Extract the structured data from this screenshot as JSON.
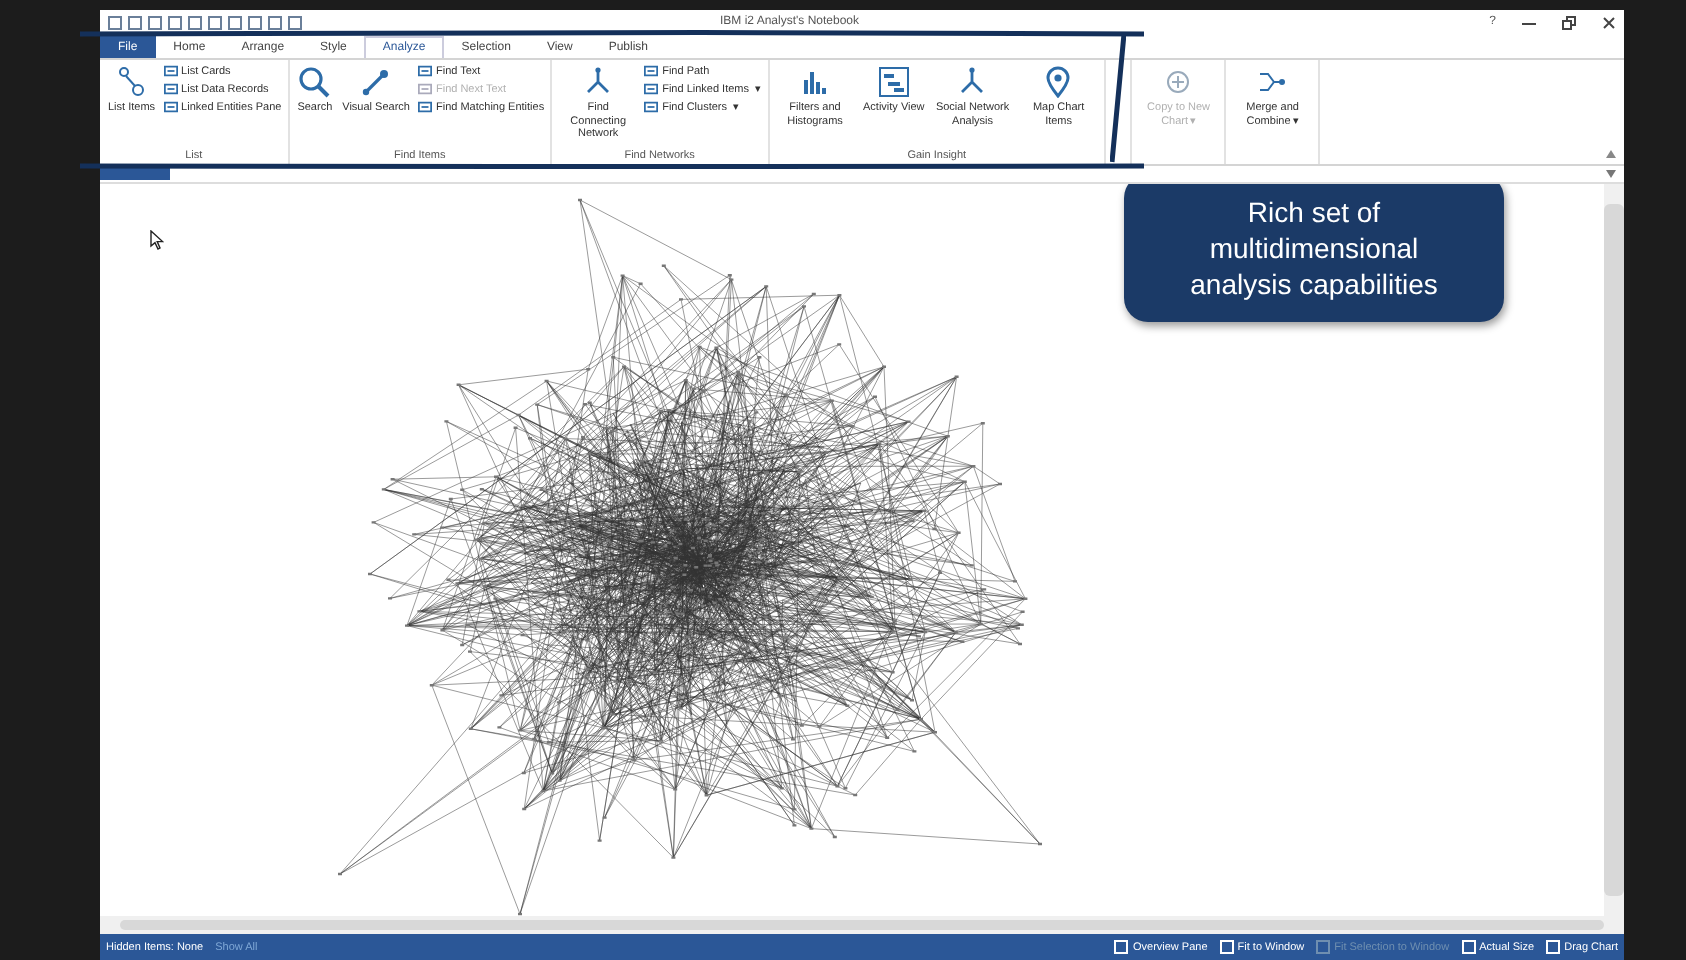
{
  "window": {
    "title": "IBM i2 Analyst's Notebook",
    "help": "?"
  },
  "tabs": [
    {
      "label": "File",
      "selected": false,
      "kind": "file"
    },
    {
      "label": "Home",
      "selected": false
    },
    {
      "label": "Arrange",
      "selected": false
    },
    {
      "label": "Style",
      "selected": false
    },
    {
      "label": "Analyze",
      "selected": true
    },
    {
      "label": "Selection",
      "selected": false
    },
    {
      "label": "View",
      "selected": false
    },
    {
      "label": "Publish",
      "selected": false
    }
  ],
  "ribbon_groups": [
    {
      "label": "List",
      "items": [
        {
          "label": "List Items",
          "kind": "large",
          "disabled": false
        },
        {
          "label": "List Cards",
          "kind": "small",
          "disabled": false
        },
        {
          "label": "List Data Records",
          "kind": "small",
          "disabled": false
        },
        {
          "label": "Linked Entities Pane",
          "kind": "small",
          "disabled": false
        }
      ]
    },
    {
      "label": "Find Items",
      "items": [
        {
          "label": "Search",
          "kind": "large",
          "disabled": false
        },
        {
          "label": "Visual Search",
          "kind": "large",
          "disabled": false
        },
        {
          "label": "Find Text",
          "kind": "small",
          "disabled": false
        },
        {
          "label": "Find Next Text",
          "kind": "small",
          "disabled": true
        },
        {
          "label": "Find Matching Entities",
          "kind": "small",
          "disabled": false
        }
      ]
    },
    {
      "label": "Find Networks",
      "items": [
        {
          "label": "Find Connecting Network",
          "kind": "large",
          "disabled": false
        },
        {
          "label": "Find Path",
          "kind": "small",
          "disabled": false
        },
        {
          "label": "Find Linked Items",
          "kind": "small",
          "disabled": false,
          "caret": "▾"
        },
        {
          "label": "Find Clusters",
          "kind": "small",
          "disabled": false,
          "caret": "▾"
        }
      ]
    },
    {
      "label": "Gain Insight",
      "items": [
        {
          "label": "Filters and Histograms",
          "kind": "large",
          "disabled": false
        },
        {
          "label": "Activity View",
          "kind": "large",
          "disabled": false
        },
        {
          "label": "Social Network Analysis",
          "kind": "large",
          "disabled": false
        },
        {
          "label": "Map Chart Items",
          "kind": "large",
          "disabled": false
        }
      ]
    },
    {
      "items": [
        {
          "label": "Copy to New Chart",
          "kind": "large",
          "disabled": true,
          "caret": "▾"
        }
      ]
    },
    {
      "items": [
        {
          "label": "Merge and Combine",
          "kind": "large",
          "disabled": false,
          "caret": "▾"
        }
      ]
    }
  ],
  "callout": {
    "text": "Rich set of multidimensional analysis capabilities"
  },
  "status_bar": {
    "hidden_items": "Hidden Items: None",
    "show_all": "Show All",
    "buttons": [
      {
        "label": "Overview Pane",
        "disabled": false
      },
      {
        "label": "Fit to Window",
        "disabled": false
      },
      {
        "label": "Fit Selection to Window",
        "disabled": true
      },
      {
        "label": "Actual Size",
        "disabled": false
      },
      {
        "label": "Drag Chart",
        "disabled": false
      }
    ]
  }
}
